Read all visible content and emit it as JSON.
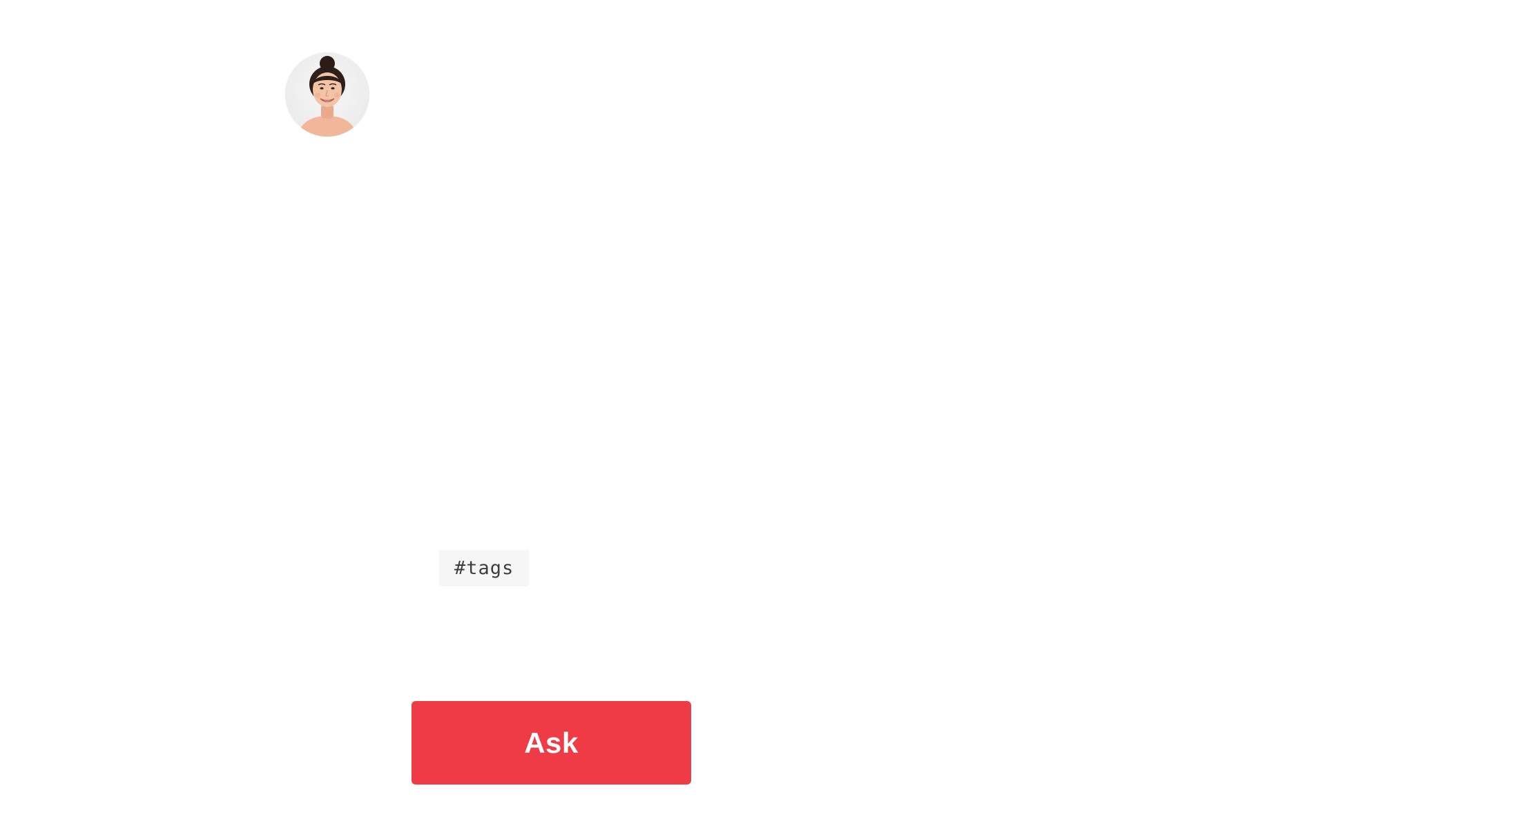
{
  "profile": {
    "avatar_icon": "user-avatar-photo"
  },
  "tags": {
    "chip_label": "#tags"
  },
  "actions": {
    "ask_label": "Ask"
  },
  "colors": {
    "accent": "#ee3b45",
    "chip_background": "#f6f6f6",
    "chip_text": "#3e3e3e",
    "page_background": "#ffffff"
  }
}
